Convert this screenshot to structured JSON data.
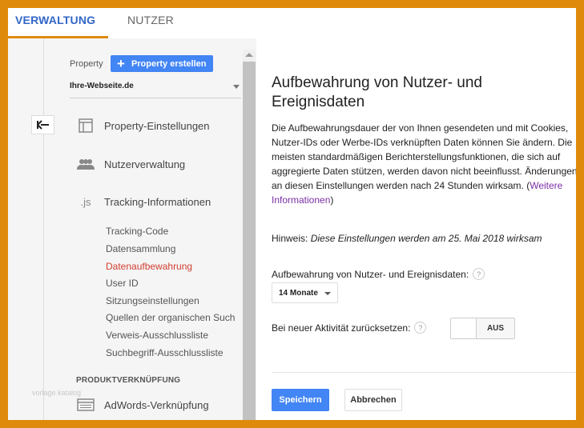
{
  "tabs": [
    {
      "label": "VERWALTUNG",
      "active": true
    },
    {
      "label": "NUTZER",
      "active": false
    }
  ],
  "sidebar": {
    "back_icon": "arrow-left-icon",
    "property_label": "Property",
    "create_button_label": "Property erstellen",
    "selected_property": "Ihre-Webseite.de",
    "items": [
      {
        "label": "Property-Einstellungen",
        "icon": "layout-icon"
      },
      {
        "label": "Nutzerverwaltung",
        "icon": "people-icon"
      },
      {
        "label": "Tracking-Informationen",
        "icon": "js-icon",
        "icon_text": ".js"
      }
    ],
    "sub_items": [
      {
        "label": "Tracking-Code",
        "active": false
      },
      {
        "label": "Datensammlung",
        "active": false
      },
      {
        "label": "Datenaufbewahrung",
        "active": true
      },
      {
        "label": "User ID",
        "active": false
      },
      {
        "label": "Sitzungseinstellungen",
        "active": false
      },
      {
        "label": "Quellen der organischen Such",
        "active": false
      },
      {
        "label": "Verweis-Ausschlussliste",
        "active": false
      },
      {
        "label": "Suchbegriff-Ausschlussliste",
        "active": false
      }
    ],
    "section_heading": "PRODUKTVERKNÜPFUNG",
    "watermark": "vorlage katalog",
    "link_item": {
      "label": "AdWords-Verknüpfung",
      "icon": "adwords-icon"
    }
  },
  "main": {
    "title": "Aufbewahrung von Nutzer- und Ereignisdaten",
    "description": "Die Aufbewahrungsdauer der von Ihnen gesendeten und mit Cookies, Nutzer-IDs oder Werbe-IDs verknüpften Daten können Sie ändern. Die meisten standardmäßigen Berichterstellungsfunktionen, die sich auf aggregierte Daten stützen, werden davon nicht beeinflusst. Änderungen an diesen Einstellungen werden nach 24 Stunden wirksam.",
    "desc_open_paren": " (",
    "more_info_link": "Weitere Informationen",
    "desc_close_paren": ")",
    "hint_label": "Hinweis: ",
    "hint_text": "Diese Einstellungen werden am 25. Mai 2018 wirksam",
    "retention_label": "Aufbewahrung von Nutzer- und Ereignisdaten:",
    "retention_value": "14 Monate",
    "reset_label": "Bei neuer Aktivität zurücksetzen:",
    "help_glyph": "?",
    "toggle_label": "AUS",
    "toggle_on": false,
    "save_label": "Speichern",
    "cancel_label": "Abbrechen"
  },
  "colors": {
    "frame": "#e08a0b",
    "accent": "#4285f4",
    "active_tab": "#3266c8",
    "active_sub_item": "#d23f31",
    "link": "#7b2fa6"
  }
}
